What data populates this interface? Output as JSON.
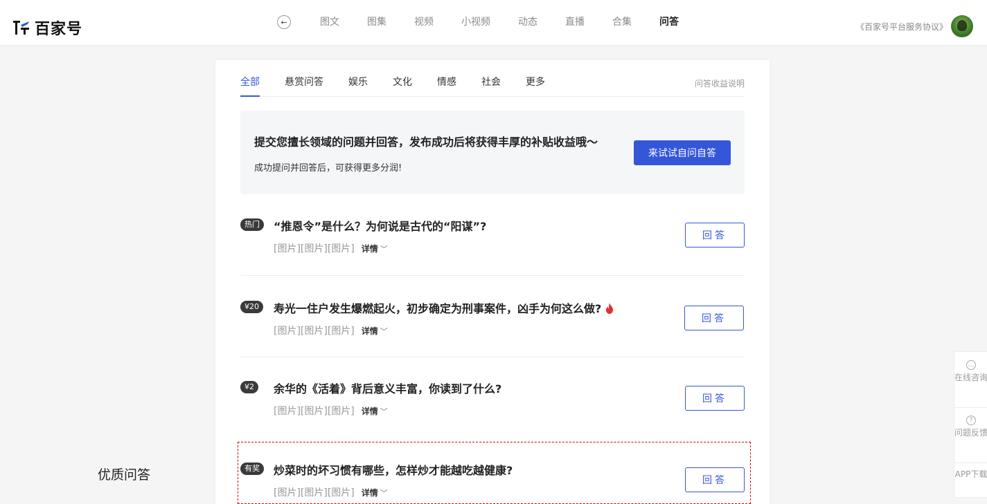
{
  "header": {
    "logo_text": "百家号",
    "nav": [
      "图文",
      "图集",
      "视频",
      "小视频",
      "动态",
      "直播",
      "合集",
      "问答"
    ],
    "active_nav": "问答",
    "agreement": "《百家号平台服务协议》"
  },
  "side_label": "优质问答",
  "tabs": {
    "items": [
      "全部",
      "悬赏问答",
      "娱乐",
      "文化",
      "情感",
      "社会",
      "更多"
    ],
    "active": "全部",
    "right_link": "问答收益说明"
  },
  "banner": {
    "title": "提交您擅长领域的问题并回答，发布成功后将获得丰厚的补贴收益哦～",
    "subtitle": "成功提问并回答后，可获得更多分润!",
    "button": "来试试自问自答"
  },
  "questions": [
    {
      "badge": "热门",
      "title": "“推恩令”是什么？为何说是古代的“阳谋”?",
      "meta": "[图片][图片][图片]",
      "detail": "详情",
      "button": "回答",
      "hot": false
    },
    {
      "badge": "¥20",
      "title": "寿光一住户发生爆燃起火，初步确定为刑事案件，凶手为何这么做?",
      "meta": "[图片][图片][图片]",
      "detail": "详情",
      "button": "回答",
      "hot": true
    },
    {
      "badge": "¥2",
      "title": "余华的《活着》背后意义丰富，你读到了什么?",
      "meta": "[图片][图片][图片]",
      "detail": "详情",
      "button": "回答",
      "hot": false
    },
    {
      "badge": "有奖",
      "title": "炒菜时的坏习惯有哪些，怎样炒才能越吃越健康?",
      "meta": "[图片][图片][图片]",
      "detail": "详情",
      "button": "回答",
      "hot": false
    }
  ],
  "float_panel": [
    {
      "icon": "chat-icon",
      "label": "在线咨询"
    },
    {
      "icon": "question-icon",
      "label": "问题反馈"
    },
    {
      "icon": "",
      "label": "APP下载"
    }
  ],
  "colors": {
    "accent": "#3456d9",
    "badge_bg": "#3a3a3a",
    "fire": "#e62e2e",
    "highlight_border": "#cc0000"
  }
}
